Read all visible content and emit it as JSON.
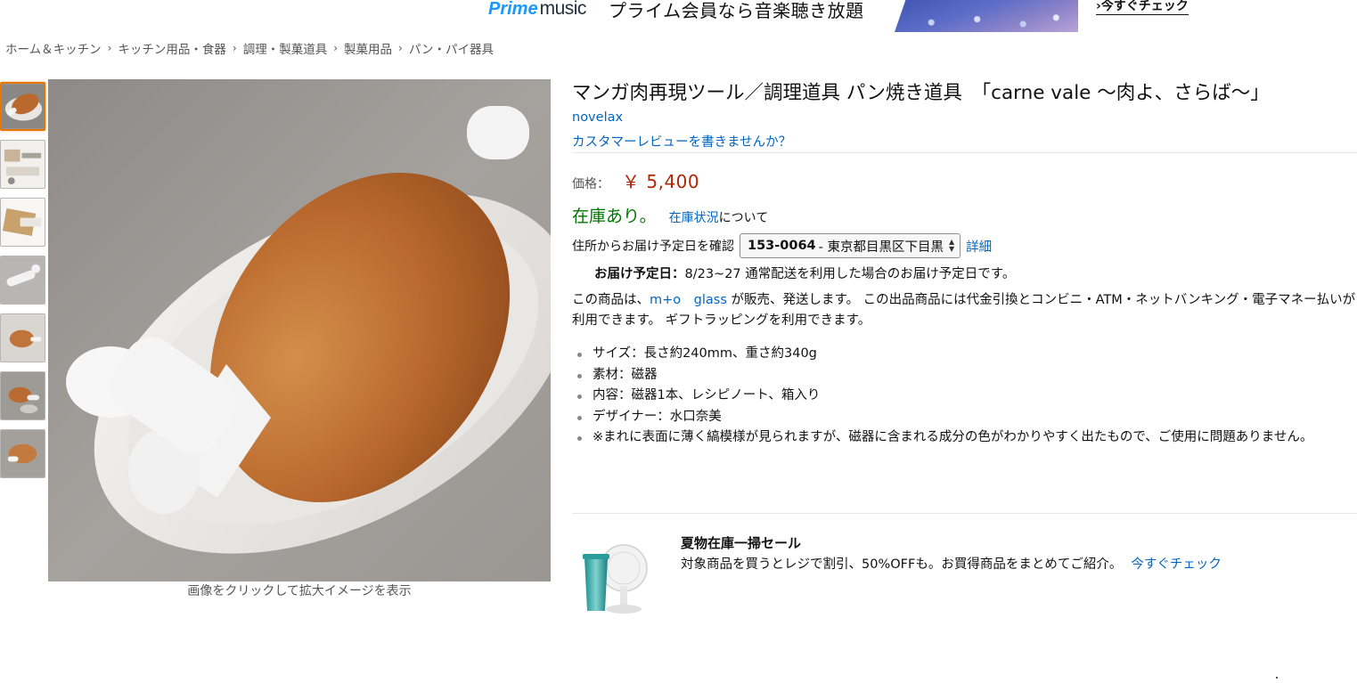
{
  "banner": {
    "logo_prime": "Prime",
    "logo_music": "music",
    "text": "プライム会員なら音楽聴き放題",
    "cta": "今すぐチェック"
  },
  "breadcrumb": [
    "ホーム＆キッチン",
    "キッチン用品・食器",
    "調理・製菓道具",
    "製菓用品",
    "パン・パイ器具"
  ],
  "gallery": {
    "thumb_count": 7,
    "active_thumb": 1,
    "caption": "画像をクリックして拡大イメージを表示"
  },
  "product": {
    "title": "マンガ肉再現ツール／調理道具 パン焼き道具　「carne vale ～肉よ、さらば～」",
    "brand": "novelax",
    "review_link": "カスタマーレビューを書きませんか？",
    "price_label": "価格：",
    "price": "￥ 5,400",
    "stock_status": "在庫あり。",
    "stock_link": "在庫状況",
    "stock_suffix": "について",
    "delivery_label": "住所からお届け予定日を確認",
    "zip_code": "153-0064",
    "zip_area": "- 東京都目黒区下目黒",
    "detail_link": "詳細",
    "eta_label": "お届け予定日：",
    "eta_text": "8/23~27 通常配送を利用した場合のお届け予定日です。",
    "seller_prefix": "この商品は、",
    "seller_name": "m+o　glass",
    "seller_suffix": " が販売、発送します。 この出品商品には代金引換とコンビニ・ATM・ネットバンキング・電子マネー払いが利用できます。 ギフトラッピングを利用できます。",
    "features": [
      "サイズ：長さ約240mm、重さ約340g",
      "素材：磁器",
      "内容：磁器1本、レシピノート、箱入り",
      "デザイナー：水口奈美",
      "※まれに表面に薄く縞模様が見られますが、磁器に含まれる成分の色がわかりやすく出たもので、ご使用に問題ありません。"
    ]
  },
  "promo": {
    "title": "夏物在庫一掃セール",
    "text": "対象商品を買うとレジで割引、50%OFFも。お買得商品をまとめてご紹介。",
    "link": "今すぐチェック"
  },
  "colors": {
    "link": "#0066c0",
    "price": "#b12704",
    "in_stock": "#007600",
    "active_thumb_border": "#e77600",
    "prime_blue": "#1a98ff"
  }
}
